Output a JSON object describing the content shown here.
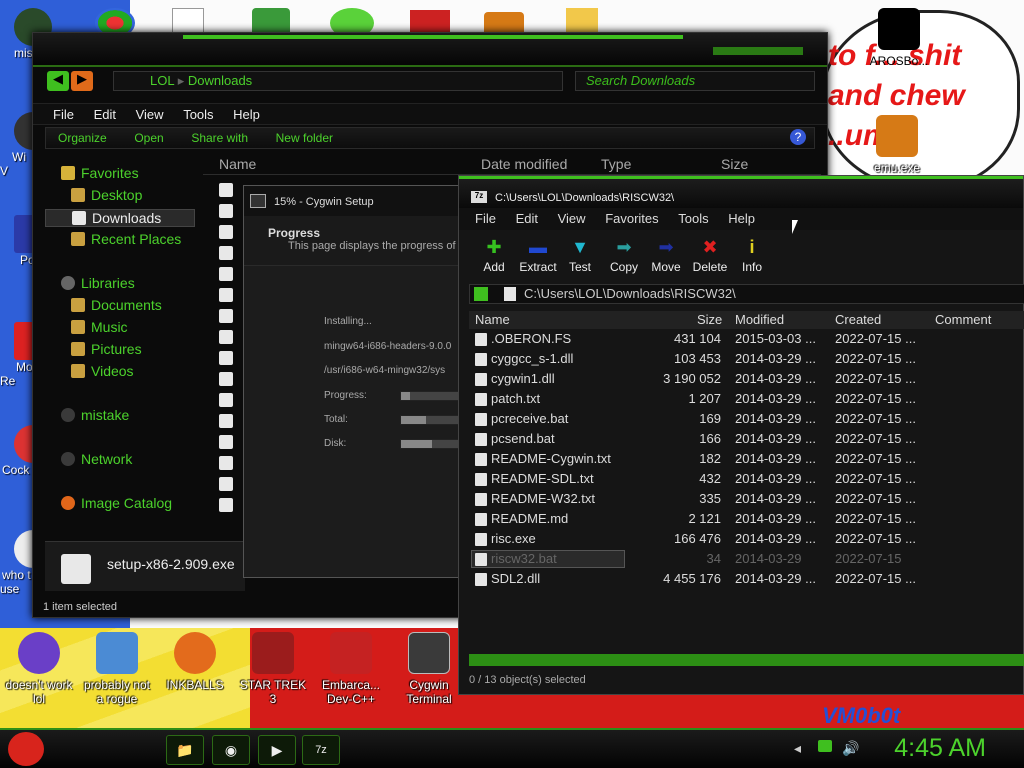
{
  "desktop": {
    "icons_left": [
      "mis",
      "Wi\nV",
      "Po",
      "Mo\nRe",
      "Cock",
      "who t\nuse"
    ],
    "icons_bottom": [
      {
        "label": "doesn't work\nlol",
        "color": "#6a3fc7"
      },
      {
        "label": "probably not\na rogue",
        "color": "#4b8bd4"
      },
      {
        "label": "INKBALLS",
        "color": "#e36b1c"
      },
      {
        "label": "STAR TREK\n3",
        "color": "#9b1c1c"
      },
      {
        "label": "Embarca...\nDev-C++",
        "color": "#c52222"
      },
      {
        "label": "Cygwin\nTerminal",
        "color": "#3a3a3a"
      }
    ],
    "icons_right": [
      "AROSBo...",
      "emu.exe"
    ],
    "wallpaper_text": "to f... shit\nand chew\n..um",
    "wallpaper_text2": "VM0b0t"
  },
  "explorer": {
    "breadcrumb": [
      "LOL",
      "Downloads"
    ],
    "search_placeholder": "Search Downloads",
    "menu": [
      "File",
      "Edit",
      "View",
      "Tools",
      "Help"
    ],
    "commands": [
      "Organize",
      "Open",
      "Share with",
      "New folder"
    ],
    "columns": [
      "Name",
      "Date modified",
      "Type",
      "Size"
    ],
    "nav": {
      "favorites": "Favorites",
      "desktop": "Desktop",
      "downloads": "Downloads",
      "recent": "Recent Places",
      "libraries": "Libraries",
      "documents": "Documents",
      "music": "Music",
      "pictures": "Pictures",
      "videos": "Videos",
      "mistake": "mistake",
      "network": "Network",
      "image_catalog": "Image Catalog"
    },
    "selected_file": "setup-x86-2.909.exe",
    "status": "1 item selected"
  },
  "cygwin": {
    "title": "15% - Cygwin Setup",
    "header": "Progress",
    "subheader": "This page displays the progress of th",
    "installing": "Installing...",
    "package": "mingw64-i686-headers-9.0.0",
    "path": "/usr/i686-w64-mingw32/sys",
    "progress_label": "Progress:",
    "total_label": "Total:",
    "disk_label": "Disk:",
    "progress": 0.15,
    "total": 0.4,
    "disk": 0.5
  },
  "zip": {
    "title": "C:\\Users\\LOL\\Downloads\\RISCW32\\",
    "menu": [
      "File",
      "Edit",
      "View",
      "Favorites",
      "Tools",
      "Help"
    ],
    "tools": [
      {
        "label": "Add",
        "icon": "✚",
        "color": "#36c020"
      },
      {
        "label": "Extract",
        "icon": "▬",
        "color": "#2048d0"
      },
      {
        "label": "Test",
        "icon": "▼",
        "color": "#20b8d0"
      },
      {
        "label": "Copy",
        "icon": "➡",
        "color": "#2a9e9e"
      },
      {
        "label": "Move",
        "icon": "➡",
        "color": "#2030a0"
      },
      {
        "label": "Delete",
        "icon": "✖",
        "color": "#e02020"
      },
      {
        "label": "Info",
        "icon": "i",
        "color": "#e0d020"
      }
    ],
    "path": "C:\\Users\\LOL\\Downloads\\RISCW32\\",
    "columns": [
      "Name",
      "Size",
      "Modified",
      "Created",
      "Comment"
    ],
    "rows": [
      {
        "name": ".OBERON.FS",
        "size": "431 104",
        "modified": "2015-03-03 ...",
        "created": "2022-07-15 ..."
      },
      {
        "name": "cyggcc_s-1.dll",
        "size": "103 453",
        "modified": "2014-03-29 ...",
        "created": "2022-07-15 ..."
      },
      {
        "name": "cygwin1.dll",
        "size": "3 190 052",
        "modified": "2014-03-29 ...",
        "created": "2022-07-15 ..."
      },
      {
        "name": "patch.txt",
        "size": "1 207",
        "modified": "2014-03-29 ...",
        "created": "2022-07-15 ..."
      },
      {
        "name": "pcreceive.bat",
        "size": "169",
        "modified": "2014-03-29 ...",
        "created": "2022-07-15 ..."
      },
      {
        "name": "pcsend.bat",
        "size": "166",
        "modified": "2014-03-29 ...",
        "created": "2022-07-15 ..."
      },
      {
        "name": "README-Cygwin.txt",
        "size": "182",
        "modified": "2014-03-29 ...",
        "created": "2022-07-15 ..."
      },
      {
        "name": "README-SDL.txt",
        "size": "432",
        "modified": "2014-03-29 ...",
        "created": "2022-07-15 ..."
      },
      {
        "name": "README-W32.txt",
        "size": "335",
        "modified": "2014-03-29 ...",
        "created": "2022-07-15 ..."
      },
      {
        "name": "README.md",
        "size": "2 121",
        "modified": "2014-03-29 ...",
        "created": "2022-07-15 ..."
      },
      {
        "name": "risc.exe",
        "size": "166 476",
        "modified": "2014-03-29 ...",
        "created": "2022-07-15 ..."
      },
      {
        "name": "riscw32.bat",
        "size": "34",
        "modified": "2014-03-29",
        "created": "2022-07-15"
      },
      {
        "name": "SDL2.dll",
        "size": "4 455 176",
        "modified": "2014-03-29 ...",
        "created": "2022-07-15 ..."
      }
    ],
    "status": "0 / 13 object(s) selected"
  },
  "taskbar": {
    "buttons": [
      "📁",
      "◉",
      "▶",
      "7z"
    ],
    "clock": "4:45 AM"
  }
}
